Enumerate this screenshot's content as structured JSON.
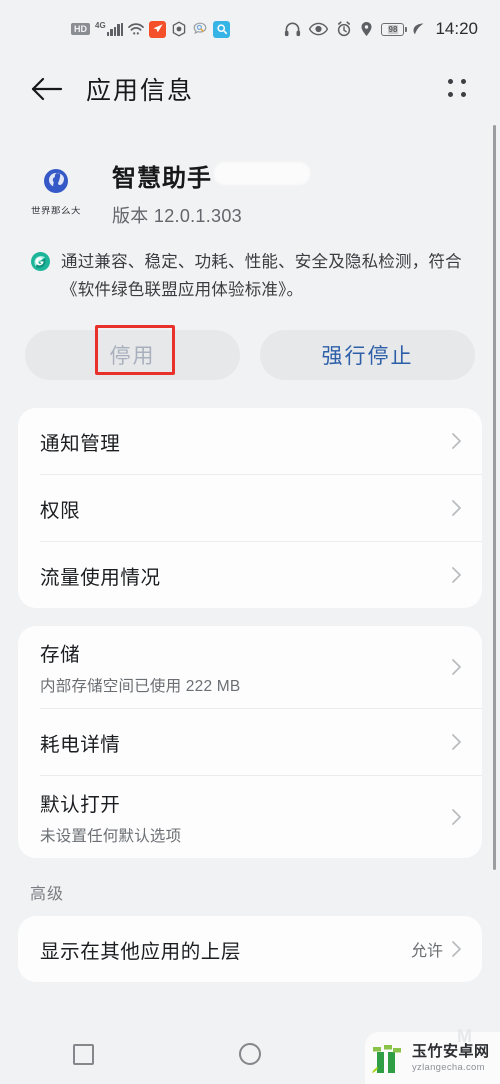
{
  "status_bar": {
    "hd_label": "HD",
    "network_label": "4G",
    "icons": [
      "hd-badge-icon",
      "signal-4g-icon",
      "wifi-icon",
      "orange-rocket-icon",
      "hexagon-shield-icon",
      "speech-bubble-search-icon",
      "blue-search-icon"
    ],
    "right_icons": [
      "headphones-icon",
      "eye-comfort-icon",
      "alarm-clock-icon",
      "location-pin-icon",
      "battery-icon",
      "power-saving-leaf-icon"
    ],
    "battery_level": "98",
    "clock": "14:20"
  },
  "header": {
    "back_icon": "arrow-left-icon",
    "title": "应用信息",
    "menu_icon": "grid-dots-icon"
  },
  "app": {
    "icon_name": "smart-assistant-app-icon",
    "icon_caption": "世界那么大",
    "name": "智慧助手",
    "version": "版本 12.0.1.303",
    "redacted_label": ""
  },
  "certification": {
    "icon_name": "green-alliance-badge-icon",
    "text": "通过兼容、稳定、功耗、性能、安全及隐私检测，符合《软件绿色联盟应用体验标准》。"
  },
  "actions": {
    "disable_label": "停用",
    "disable_enabled": false,
    "force_stop_label": "强行停止",
    "annotation_color": "#e8312b",
    "primary_color": "#2c5fa8",
    "disabled_color": "#a9b0bd"
  },
  "cards": [
    {
      "rows": [
        {
          "title": "通知管理",
          "sub": "",
          "value": "",
          "chevron": "chevron-right-icon"
        },
        {
          "title": "权限",
          "sub": "",
          "value": "",
          "chevron": "chevron-right-icon"
        },
        {
          "title": "流量使用情况",
          "sub": "",
          "value": "",
          "chevron": "chevron-right-icon"
        }
      ]
    },
    {
      "rows": [
        {
          "title": "存储",
          "sub": "内部存储空间已使用 222 MB",
          "value": "",
          "chevron": "chevron-right-icon"
        },
        {
          "title": "耗电详情",
          "sub": "",
          "value": "",
          "chevron": "chevron-right-icon"
        },
        {
          "title": "默认打开",
          "sub": "未设置任何默认选项",
          "value": "",
          "chevron": "chevron-right-icon"
        }
      ]
    }
  ],
  "advanced": {
    "section_label": "高级",
    "rows": [
      {
        "title": "显示在其他应用的上层",
        "sub": "",
        "value": "允许",
        "chevron": "chevron-right-icon"
      }
    ]
  },
  "nav_bar": {
    "recents_icon": "square-recents-icon",
    "home_icon": "circle-home-icon",
    "back_icon": "triangle-back-icon"
  },
  "watermark": {
    "logo_icon": "bamboo-logo-icon",
    "site_name": "玉竹安卓网",
    "site_url": "yzlangecha.com"
  },
  "colors": {
    "page_bg": "#f1f2f3",
    "card_bg": "#fdfdfd",
    "text_primary": "#1b1d20",
    "text_secondary": "#6b6f74",
    "accent_blue": "#2c5fa8",
    "annotation_red": "#e8312b",
    "cert_green": "#1cb59a"
  }
}
